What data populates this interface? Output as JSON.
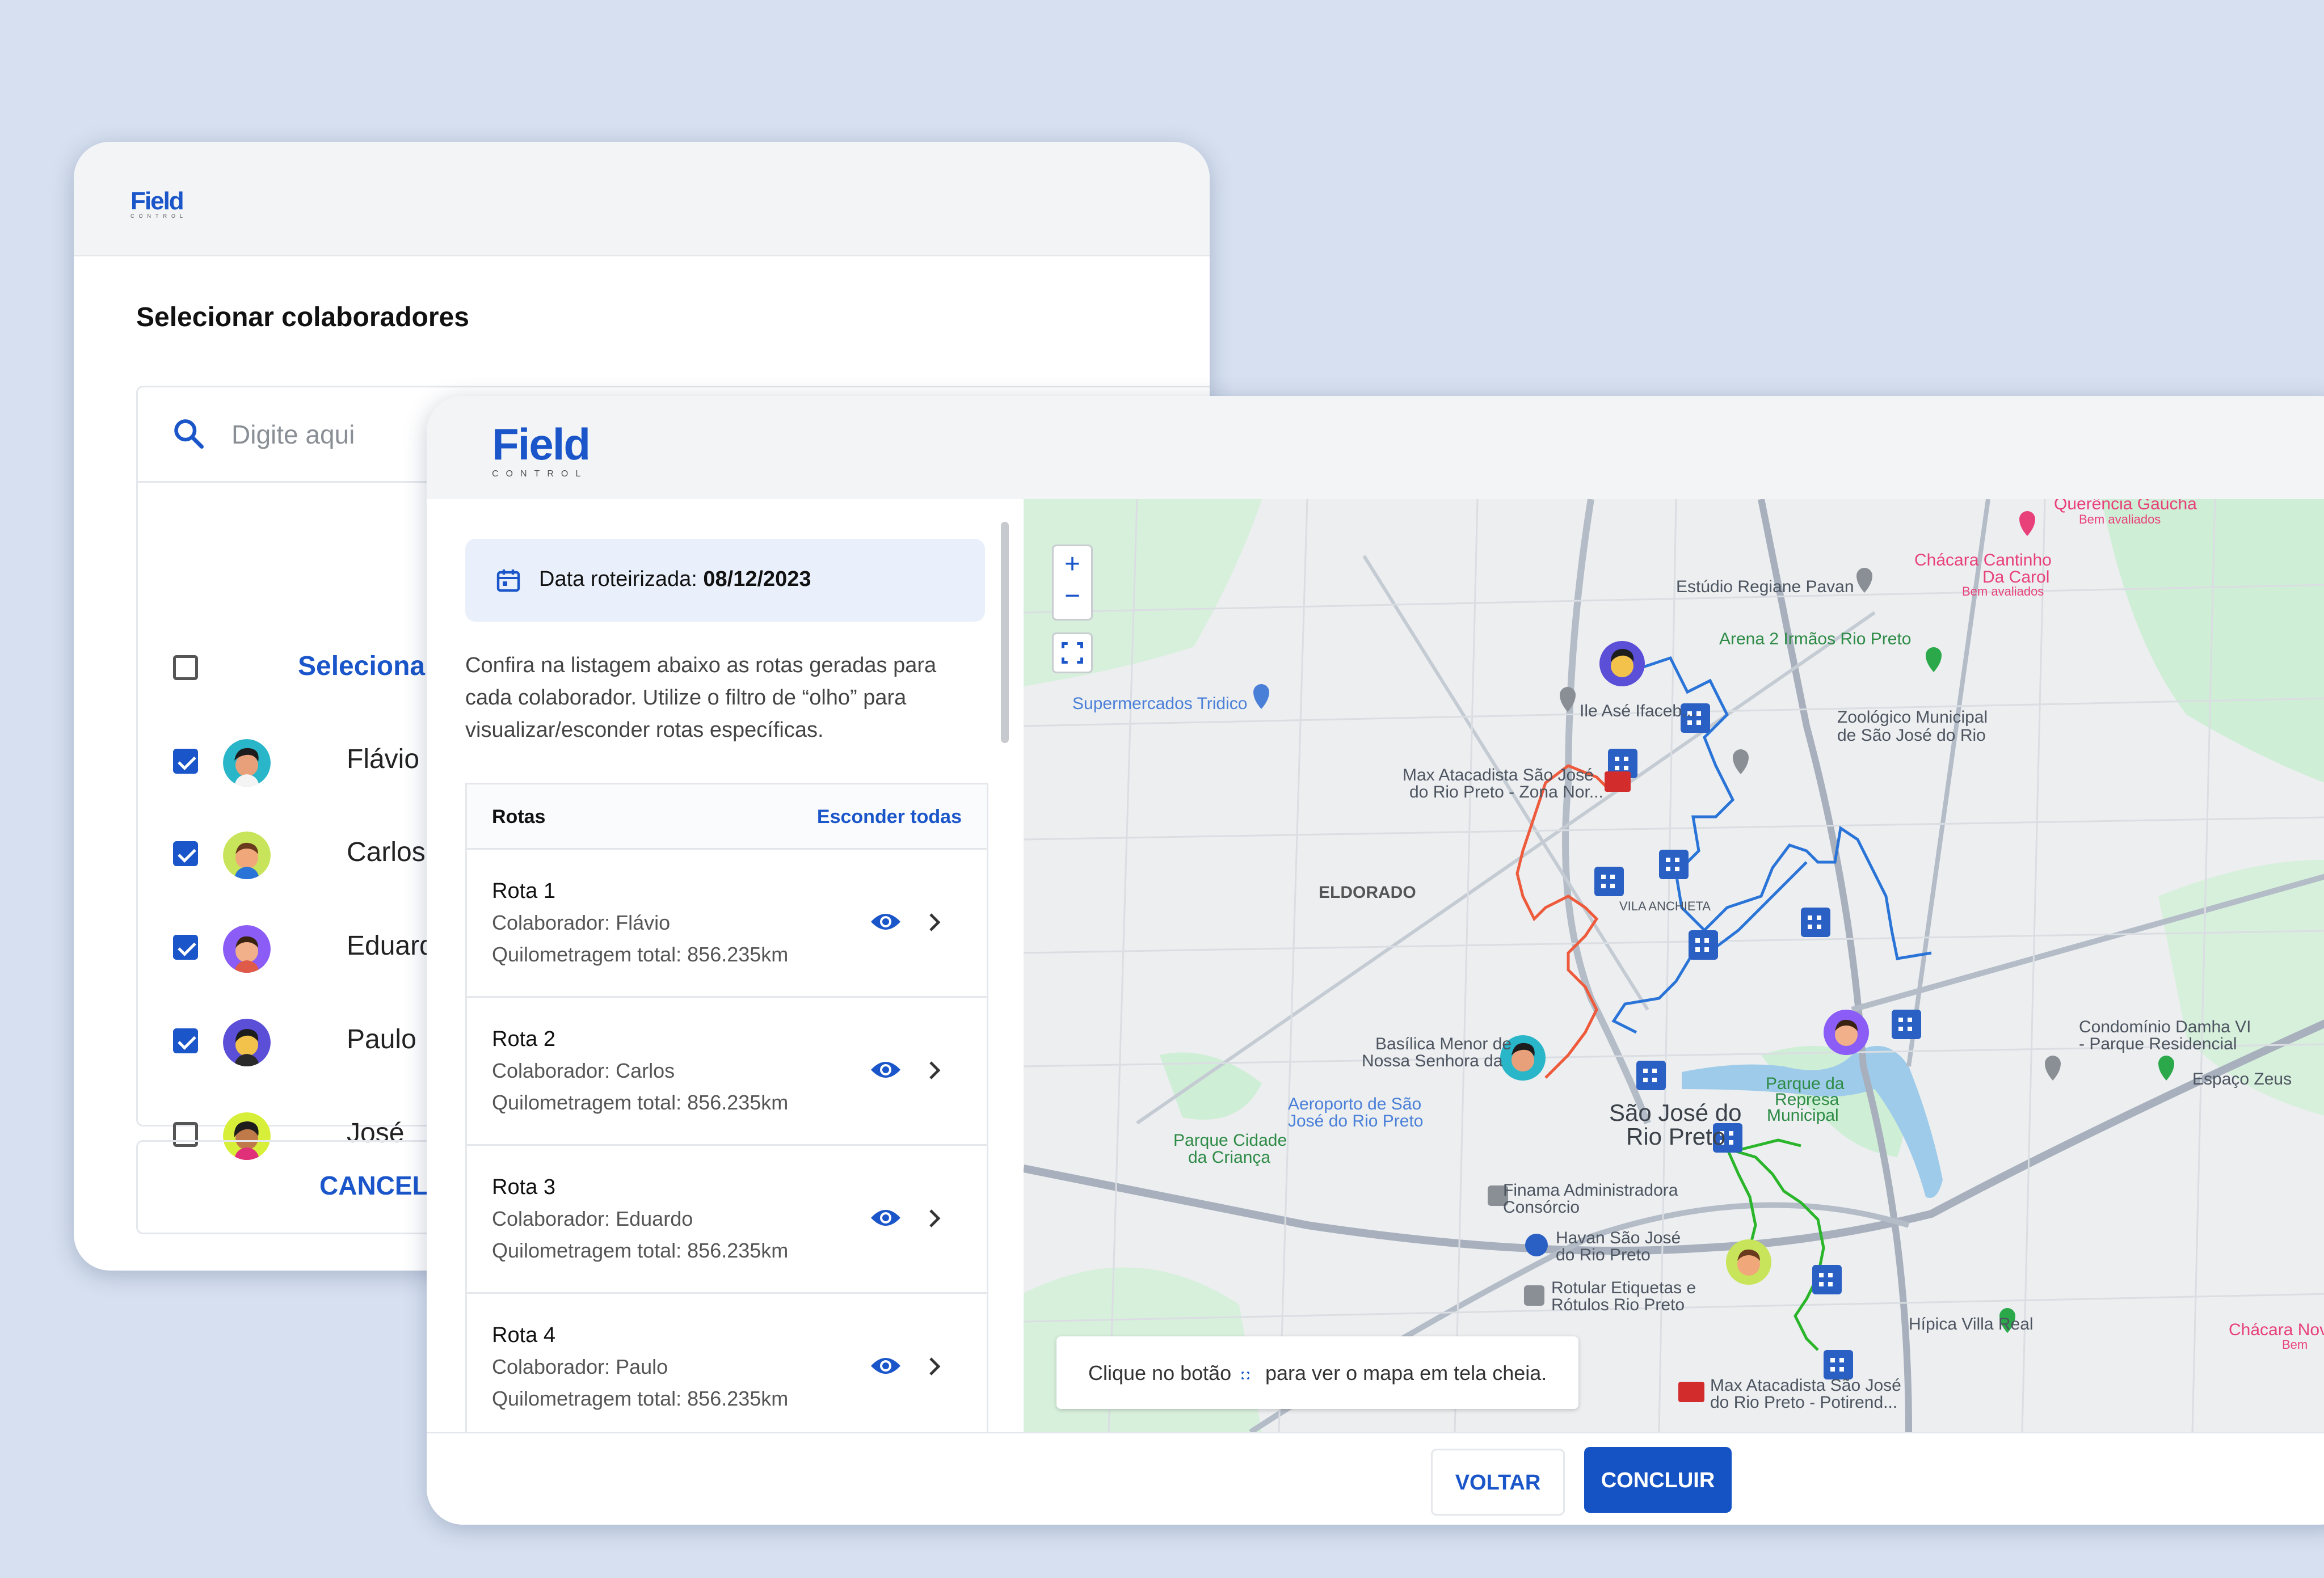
{
  "colors": {
    "primary": "#1a56c9",
    "background": "#d6e0f0",
    "route_blue": "#2a74d8",
    "route_red": "#ee5a3c",
    "route_green": "#2ab52a"
  },
  "back_window": {
    "logo": "Field",
    "logo_sub": "CONTROL",
    "title": "Selecionar colaboradores",
    "search": {
      "placeholder": "Digite aqui",
      "icon": "search-icon"
    },
    "select_all_label": "Selecionar todos",
    "collaborators": [
      {
        "name": "Flávio",
        "checked": true
      },
      {
        "name": "Carlos",
        "checked": true
      },
      {
        "name": "Eduardo",
        "checked": true
      },
      {
        "name": "Paulo",
        "checked": true
      },
      {
        "name": "José",
        "checked": false
      }
    ],
    "cancel_label": "CANCELA"
  },
  "front_window": {
    "logo": "Field",
    "logo_sub": "CONTROL",
    "date_label": "Data roteirizada:",
    "date_value": "08/12/2023",
    "description": "Confira na listagem abaixo as rotas geradas para cada colaborador. Utilize o filtro de “olho” para visualizar/esconder rotas específicas.",
    "routes_header": "Rotas",
    "hide_all": "Esconder todas",
    "routes": [
      {
        "name": "Rota 1",
        "collaborator": "Colaborador: Flávio",
        "km": "Quilometragem total: 856.235km"
      },
      {
        "name": "Rota 2",
        "collaborator": "Colaborador: Carlos",
        "km": "Quilometragem total: 856.235km"
      },
      {
        "name": "Rota 3",
        "collaborator": "Colaborador: Eduardo",
        "km": "Quilometragem total: 856.235km"
      },
      {
        "name": "Rota 4",
        "collaborator": "Colaborador: Paulo",
        "km": "Quilometragem total: 856.235km"
      }
    ],
    "map": {
      "zoom_in": "+",
      "zoom_out": "−",
      "hint_before": "Clique no botão",
      "hint_after": "para ver o mapa em tela cheia.",
      "labels": {
        "city": "São José do",
        "city2": "Rio Preto",
        "eldorado": "ELDORADO",
        "estudio": "Estúdio Regiane Pavan",
        "arena": "Arena 2 Irmãos Rio Preto",
        "super": "Supermercados Tridico",
        "zoo1": "Zoológico Municipal",
        "zoo2": "de São José do Rio",
        "max1": "Max Atacadista São José",
        "max2": "do Rio Preto - Zona Nor...",
        "basilica1": "Basílica Menor de",
        "basilica2": "Nossa Senhora da",
        "aero1": "Aeroporto de São",
        "aero2": "José do Rio Preto",
        "parque1": "Parque Cidade",
        "parque2": "da Criança",
        "finama1": "Finama Administradora",
        "finama2": "Consórcio",
        "havan1": "Havan São José",
        "havan2": "do Rio Preto",
        "rotular1": "Rotular Etiquetas e",
        "rotular2": "Rótulos Rio Preto",
        "max3": "Max Atacadista São José",
        "max4": "do Rio Preto - Potirend...",
        "damha1": "Condomínio Damha VI",
        "damha2": "- Parque Residencial",
        "zeus": "Espaço Zeus",
        "hipica": "Hípica Villa Real",
        "chacara1": "Chácara Cantinho",
        "chacara2": "Da Carol",
        "chacara3": "Bem avaliados",
        "querencia": "Querência Gaúcha",
        "querencia2": "Bem avaliados",
        "represa1": "Parque da",
        "represa2": "Represa",
        "represa3": "Municipal",
        "ile": "Ile Asé Ifaceb...",
        "vila_anchieta": "VILA ANCHIETA",
        "chacara_nova": "Chácara Nova",
        "chacara_nova2": "Bem"
      }
    },
    "buttons": {
      "back": "VOLTAR",
      "finish": "CONCLUIR"
    }
  }
}
